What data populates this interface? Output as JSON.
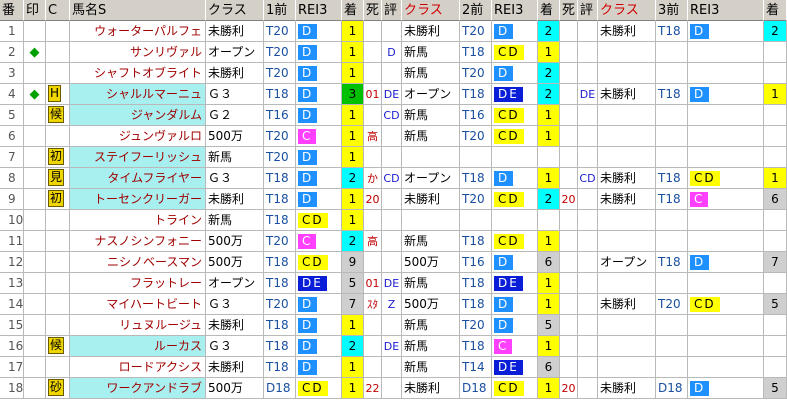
{
  "headers": {
    "num": "番",
    "mark": "印",
    "c": "C",
    "name": "馬名S",
    "kla1": "クラス",
    "zen1": "1前",
    "rei1": "REI3",
    "cha1": "着",
    "sm": "死",
    "ev": "評",
    "kla2": "クラス",
    "zen2": "2前",
    "rei2": "REI3",
    "cha2": "着",
    "sm2": "死",
    "ev2": "評",
    "kla3": "クラス",
    "zen3": "3前",
    "rei3": "REI3",
    "cha3": "着"
  },
  "colors": {
    "pill_blue": "#1e90ff",
    "pill_yellow": "#ffff00",
    "pill_dark": "#0a1ed8",
    "pill_pink": "#ff40ff",
    "first_green": "#00c000",
    "name_red": "#a00000"
  },
  "rows": [
    {
      "num": "1",
      "mark": "",
      "tag": "",
      "name": "ウォーターパルフェ",
      "cyan": false,
      "r1": {
        "kla": "未勝利",
        "td": "T20",
        "rei": "D",
        "rs": "blue",
        "pt": "1",
        "ps": "yellow",
        "sm": "",
        "ev": ""
      },
      "r2": {
        "kla": "未勝利",
        "td": "T20",
        "rei": "D",
        "rs": "blue",
        "pt": "2",
        "ps": "cyan",
        "sm": "",
        "ev": ""
      },
      "r3": {
        "kla": "未勝利",
        "td": "T18",
        "rei": "D",
        "rs": "blue",
        "pt": "2",
        "ps": "cyan"
      }
    },
    {
      "num": "2",
      "mark": "◆",
      "tag": "",
      "name": "サンリヴァル",
      "cyan": false,
      "r1": {
        "kla": "オープン",
        "td": "T20",
        "rei": "D",
        "rs": "blue",
        "pt": "1",
        "ps": "yellow",
        "sm": "",
        "ev": "D"
      },
      "r2": {
        "kla": "新馬",
        "td": "T18",
        "rei": "CD",
        "rs": "yellow",
        "pt": "1",
        "ps": "yellow",
        "sm": "",
        "ev": ""
      },
      "r3": {
        "kla": "",
        "td": "",
        "rei": "",
        "rs": "",
        "pt": "",
        "ps": ""
      }
    },
    {
      "num": "3",
      "mark": "",
      "tag": "",
      "name": "シャフトオブライト",
      "cyan": false,
      "r1": {
        "kla": "未勝利",
        "td": "T20",
        "rei": "D",
        "rs": "blue",
        "pt": "1",
        "ps": "yellow",
        "sm": "",
        "ev": ""
      },
      "r2": {
        "kla": "新馬",
        "td": "T20",
        "rei": "D",
        "rs": "blue",
        "pt": "2",
        "ps": "cyan",
        "sm": "",
        "ev": ""
      },
      "r3": {
        "kla": "",
        "td": "",
        "rei": "",
        "rs": "",
        "pt": "",
        "ps": ""
      }
    },
    {
      "num": "4",
      "mark": "◆",
      "tag": "H",
      "name": "シャルルマーニュ",
      "cyan": true,
      "r1": {
        "kla": "Ｇ３",
        "td": "T18",
        "rei": "D",
        "rs": "blue",
        "pt": "3",
        "ps": "green",
        "sm": "01",
        "ev": "DE"
      },
      "r2": {
        "kla": "オープン",
        "td": "T18",
        "rei": "DE",
        "rs": "dark",
        "pt": "2",
        "ps": "cyan",
        "sm": "",
        "ev": "DE"
      },
      "r3": {
        "kla": "未勝利",
        "td": "T18",
        "rei": "D",
        "rs": "blue",
        "pt": "1",
        "ps": "yellow"
      }
    },
    {
      "num": "5",
      "mark": "",
      "tag": "候",
      "name": "ジャンダルム",
      "cyan": true,
      "r1": {
        "kla": "Ｇ２",
        "td": "T16",
        "rei": "D",
        "rs": "blue",
        "pt": "1",
        "ps": "yellow",
        "sm": "",
        "ev": "CD"
      },
      "r2": {
        "kla": "新馬",
        "td": "T16",
        "rei": "CD",
        "rs": "yellow",
        "pt": "1",
        "ps": "yellow",
        "sm": "",
        "ev": ""
      },
      "r3": {
        "kla": "",
        "td": "",
        "rei": "",
        "rs": "",
        "pt": "",
        "ps": ""
      }
    },
    {
      "num": "6",
      "mark": "",
      "tag": "",
      "name": "ジュンヴァルロ",
      "cyan": false,
      "r1": {
        "kla": "500万",
        "td": "T20",
        "rei": "C",
        "rs": "pink",
        "pt": "1",
        "ps": "yellow",
        "sm": "高",
        "ev": ""
      },
      "r2": {
        "kla": "新馬",
        "td": "T20",
        "rei": "CD",
        "rs": "yellow",
        "pt": "1",
        "ps": "yellow",
        "sm": "",
        "ev": ""
      },
      "r3": {
        "kla": "",
        "td": "",
        "rei": "",
        "rs": "",
        "pt": "",
        "ps": ""
      }
    },
    {
      "num": "7",
      "mark": "",
      "tag": "初",
      "name": "ステイフーリッシュ",
      "cyan": true,
      "r1": {
        "kla": "新馬",
        "td": "T20",
        "rei": "D",
        "rs": "blue",
        "pt": "1",
        "ps": "yellow",
        "sm": "",
        "ev": ""
      },
      "r2": {
        "kla": "",
        "td": "",
        "rei": "",
        "rs": "",
        "pt": "",
        "ps": "",
        "sm": "",
        "ev": ""
      },
      "r3": {
        "kla": "",
        "td": "",
        "rei": "",
        "rs": "",
        "pt": "",
        "ps": ""
      }
    },
    {
      "num": "8",
      "mark": "",
      "tag": "見",
      "name": "タイムフライヤー",
      "cyan": true,
      "r1": {
        "kla": "Ｇ３",
        "td": "T18",
        "rei": "D",
        "rs": "blue",
        "pt": "2",
        "ps": "cyan",
        "sm": "か",
        "ev": "CD"
      },
      "r2": {
        "kla": "オープン",
        "td": "T18",
        "rei": "D",
        "rs": "blue",
        "pt": "1",
        "ps": "yellow",
        "sm": "",
        "ev": "CD"
      },
      "r3": {
        "kla": "未勝利",
        "td": "T18",
        "rei": "CD",
        "rs": "yellow",
        "pt": "1",
        "ps": "yellow"
      }
    },
    {
      "num": "9",
      "mark": "",
      "tag": "初",
      "name": "トーセンクリーガー",
      "cyan": true,
      "r1": {
        "kla": "未勝利",
        "td": "T18",
        "rei": "D",
        "rs": "blue",
        "pt": "1",
        "ps": "yellow",
        "sm": "20",
        "ev": ""
      },
      "r2": {
        "kla": "未勝利",
        "td": "T20",
        "rei": "CD",
        "rs": "yellow",
        "pt": "2",
        "ps": "cyan",
        "sm": "20",
        "ev": ""
      },
      "r3": {
        "kla": "未勝利",
        "td": "T18",
        "rei": "C",
        "rs": "pink",
        "pt": "6",
        "ps": "gray"
      }
    },
    {
      "num": "10",
      "mark": "",
      "tag": "",
      "name": "トライン",
      "cyan": false,
      "r1": {
        "kla": "新馬",
        "td": "T18",
        "rei": "CD",
        "rs": "yellow",
        "pt": "1",
        "ps": "yellow",
        "sm": "",
        "ev": ""
      },
      "r2": {
        "kla": "",
        "td": "",
        "rei": "",
        "rs": "",
        "pt": "",
        "ps": "",
        "sm": "",
        "ev": ""
      },
      "r3": {
        "kla": "",
        "td": "",
        "rei": "",
        "rs": "",
        "pt": "",
        "ps": ""
      }
    },
    {
      "num": "11",
      "mark": "",
      "tag": "",
      "name": "ナスノシンフォニー",
      "cyan": false,
      "r1": {
        "kla": "500万",
        "td": "T20",
        "rei": "C",
        "rs": "pink",
        "pt": "2",
        "ps": "cyan",
        "sm": "高",
        "ev": ""
      },
      "r2": {
        "kla": "新馬",
        "td": "T18",
        "rei": "CD",
        "rs": "yellow",
        "pt": "1",
        "ps": "yellow",
        "sm": "",
        "ev": ""
      },
      "r3": {
        "kla": "",
        "td": "",
        "rei": "",
        "rs": "",
        "pt": "",
        "ps": ""
      }
    },
    {
      "num": "12",
      "mark": "",
      "tag": "",
      "name": "ニシノベースマン",
      "cyan": false,
      "r1": {
        "kla": "500万",
        "td": "T18",
        "rei": "CD",
        "rs": "yellow",
        "pt": "9",
        "ps": "gray",
        "sm": "",
        "ev": ""
      },
      "r2": {
        "kla": "500万",
        "td": "T16",
        "rei": "D",
        "rs": "blue",
        "pt": "6",
        "ps": "gray",
        "sm": "",
        "ev": ""
      },
      "r3": {
        "kla": "オープン",
        "td": "T18",
        "rei": "D",
        "rs": "blue",
        "pt": "7",
        "ps": "gray"
      }
    },
    {
      "num": "13",
      "mark": "",
      "tag": "",
      "name": "フラットレー",
      "cyan": false,
      "r1": {
        "kla": "オープン",
        "td": "T18",
        "rei": "DE",
        "rs": "dark",
        "pt": "5",
        "ps": "gray",
        "sm": "01",
        "ev": "DE"
      },
      "r2": {
        "kla": "新馬",
        "td": "T18",
        "rei": "DE",
        "rs": "dark",
        "pt": "1",
        "ps": "yellow",
        "sm": "",
        "ev": ""
      },
      "r3": {
        "kla": "",
        "td": "",
        "rei": "",
        "rs": "",
        "pt": "",
        "ps": ""
      }
    },
    {
      "num": "14",
      "mark": "",
      "tag": "",
      "name": "マイハートビート",
      "cyan": false,
      "r1": {
        "kla": "Ｇ３",
        "td": "T20",
        "rei": "D",
        "rs": "blue",
        "pt": "7",
        "ps": "gray",
        "sm": "ｽﾀ",
        "ev": "Z"
      },
      "r2": {
        "kla": "500万",
        "td": "T18",
        "rei": "D",
        "rs": "blue",
        "pt": "1",
        "ps": "yellow",
        "sm": "",
        "ev": ""
      },
      "r3": {
        "kla": "未勝利",
        "td": "T20",
        "rei": "CD",
        "rs": "yellow",
        "pt": "5",
        "ps": "gray"
      }
    },
    {
      "num": "15",
      "mark": "",
      "tag": "",
      "name": "リュヌルージュ",
      "cyan": false,
      "r1": {
        "kla": "未勝利",
        "td": "T18",
        "rei": "D",
        "rs": "blue",
        "pt": "1",
        "ps": "yellow",
        "sm": "",
        "ev": ""
      },
      "r2": {
        "kla": "新馬",
        "td": "T20",
        "rei": "D",
        "rs": "blue",
        "pt": "5",
        "ps": "gray",
        "sm": "",
        "ev": ""
      },
      "r3": {
        "kla": "",
        "td": "",
        "rei": "",
        "rs": "",
        "pt": "",
        "ps": ""
      }
    },
    {
      "num": "16",
      "mark": "",
      "tag": "候",
      "name": "ルーカス",
      "cyan": true,
      "r1": {
        "kla": "Ｇ３",
        "td": "T18",
        "rei": "D",
        "rs": "blue",
        "pt": "2",
        "ps": "cyan",
        "sm": "",
        "ev": "DE"
      },
      "r2": {
        "kla": "新馬",
        "td": "T18",
        "rei": "C",
        "rs": "pink",
        "pt": "1",
        "ps": "yellow",
        "sm": "",
        "ev": ""
      },
      "r3": {
        "kla": "",
        "td": "",
        "rei": "",
        "rs": "",
        "pt": "",
        "ps": ""
      }
    },
    {
      "num": "17",
      "mark": "",
      "tag": "",
      "name": "ロードアクシス",
      "cyan": false,
      "r1": {
        "kla": "未勝利",
        "td": "T18",
        "rei": "D",
        "rs": "blue",
        "pt": "1",
        "ps": "yellow",
        "sm": "",
        "ev": ""
      },
      "r2": {
        "kla": "新馬",
        "td": "T14",
        "rei": "DE",
        "rs": "dark",
        "pt": "6",
        "ps": "gray",
        "sm": "",
        "ev": ""
      },
      "r3": {
        "kla": "",
        "td": "",
        "rei": "",
        "rs": "",
        "pt": "",
        "ps": ""
      }
    },
    {
      "num": "18",
      "mark": "",
      "tag": "砂",
      "name": "ワークアンドラブ",
      "cyan": true,
      "r1": {
        "kla": "500万",
        "td": "D18",
        "rei": "CD",
        "rs": "yellow",
        "pt": "1",
        "ps": "yellow",
        "sm": "22",
        "ev": ""
      },
      "r2": {
        "kla": "未勝利",
        "td": "D18",
        "rei": "CD",
        "rs": "yellow",
        "pt": "1",
        "ps": "yellow",
        "sm": "20",
        "ev": ""
      },
      "r3": {
        "kla": "未勝利",
        "td": "D18",
        "rei": "D",
        "rs": "blue",
        "pt": "5",
        "ps": "gray"
      }
    }
  ]
}
